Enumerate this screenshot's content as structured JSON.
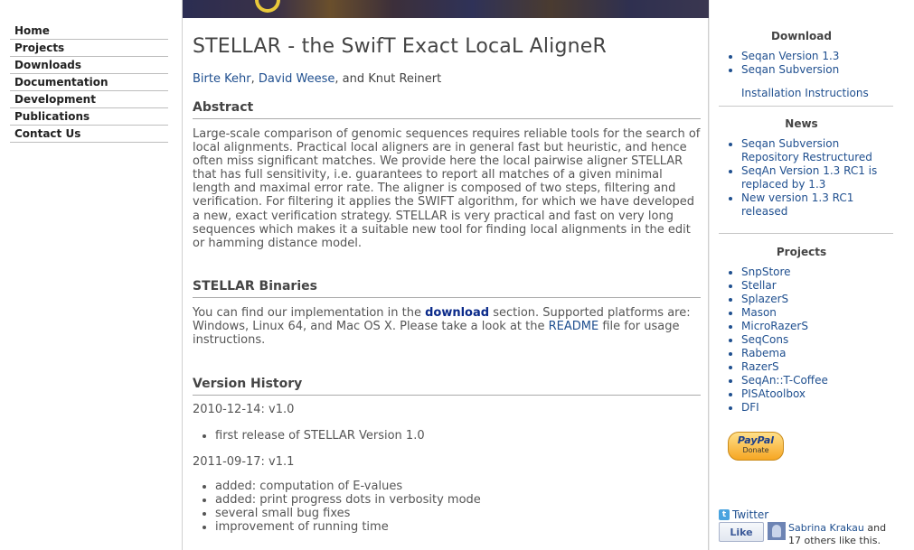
{
  "nav": {
    "items": [
      "Home",
      "Projects",
      "Downloads",
      "Documentation",
      "Development",
      "Publications",
      "Contact Us"
    ]
  },
  "main": {
    "title": "STELLAR - the SwifT Exact LocaL AligneR",
    "authors": [
      {
        "name": "Birte Kehr",
        "link": true
      },
      {
        "name": "David Weese",
        "link": true
      },
      {
        "name": "Knut Reinert",
        "link": false
      }
    ],
    "author_sep1": ", ",
    "author_sep2": ", and ",
    "abstract": {
      "heading": "Abstract",
      "text": "Large-scale comparison of genomic sequences requires reliable tools for the search of local alignments. Practical local aligners are in general fast but heuristic, and hence often miss significant matches. We provide here the local pairwise aligner STELLAR that has full sensitivity, i.e. guarantees to report all matches of a given minimal length and maximal error rate. The aligner is composed of two steps, filtering and verification. For filtering it applies the SWIFT algorithm, for which we have developed a new, exact verification strategy. STELLAR is very practical and fast on very long sequences which makes it a suitable new tool for finding local alignments in the edit or hamming distance model."
    },
    "binaries": {
      "heading": "STELLAR Binaries",
      "text_before": "You can find our implementation in the ",
      "download_link": "download",
      "text_middle": " section. Supported platforms are: Windows, Linux 64, and Mac OS X. Please take a look at the ",
      "readme_link": "README",
      "text_after": " file for usage instructions."
    },
    "history": {
      "heading": "Version History",
      "versions": [
        {
          "date": "2010-12-14: v1.0",
          "changes": [
            "first release of STELLAR Version 1.0"
          ]
        },
        {
          "date": "2011-09-17: v1.1",
          "changes": [
            "added: computation of E-values",
            "added: print progress dots in verbosity mode",
            "several small bug fixes",
            "improvement of running time"
          ]
        }
      ]
    }
  },
  "sidebar": {
    "download": {
      "title": "Download",
      "links": [
        "Seqan Version 1.3",
        "Seqan Subversion"
      ],
      "install": "Installation Instructions"
    },
    "news": {
      "title": "News",
      "items": [
        "Seqan Subversion Repository Restructured",
        "SeqAn Version 1.3 RC1 is replaced by 1.3",
        "New version 1.3 RC1 released"
      ]
    },
    "projects": {
      "title": "Projects",
      "items": [
        "SnpStore",
        "Stellar",
        "SplazerS",
        "Mason",
        "MicroRazerS",
        "SeqCons",
        "Rabema",
        "RazerS",
        "SeqAn::T-Coffee",
        "PISAtoolbox",
        "DFI"
      ]
    },
    "paypal": {
      "brand": "PayPal",
      "label": "Donate"
    },
    "twitter": "Twitter",
    "facebook": {
      "like": "Like",
      "person": "Sabrina Krakau",
      "text_and": " and",
      "others": "17 others like this."
    }
  },
  "colors": {
    "link": "#1f4f8f",
    "banner": "#2b2d52"
  }
}
